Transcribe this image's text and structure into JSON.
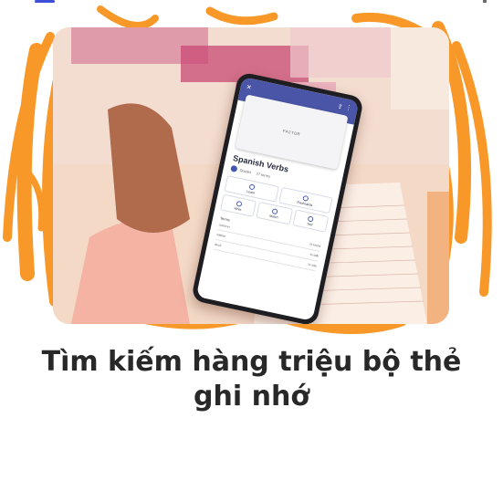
{
  "colors": {
    "accent_orange": "#f7931e",
    "headline": "#282828",
    "app_bar": "#4a55a8",
    "brand_blue": "#3d4ed8"
  },
  "phone_screen": {
    "card_label": "FACTOR",
    "deck_title": "Spanish Verbs",
    "author": "Quizlet",
    "terms_count": "27 terms",
    "modes": [
      "Learn",
      "Flashcards",
      "Write",
      "Match",
      "Test"
    ],
    "section": "Terms",
    "rows": [
      {
        "term": "conocer",
        "definition": "to know"
      },
      {
        "term": "hablar",
        "definition": "to talk"
      },
      {
        "term": "decir",
        "definition": "to say"
      }
    ]
  },
  "headline": {
    "line1": "Tìm kiếm hàng triệu bộ thẻ",
    "line2": "ghi nhớ"
  }
}
